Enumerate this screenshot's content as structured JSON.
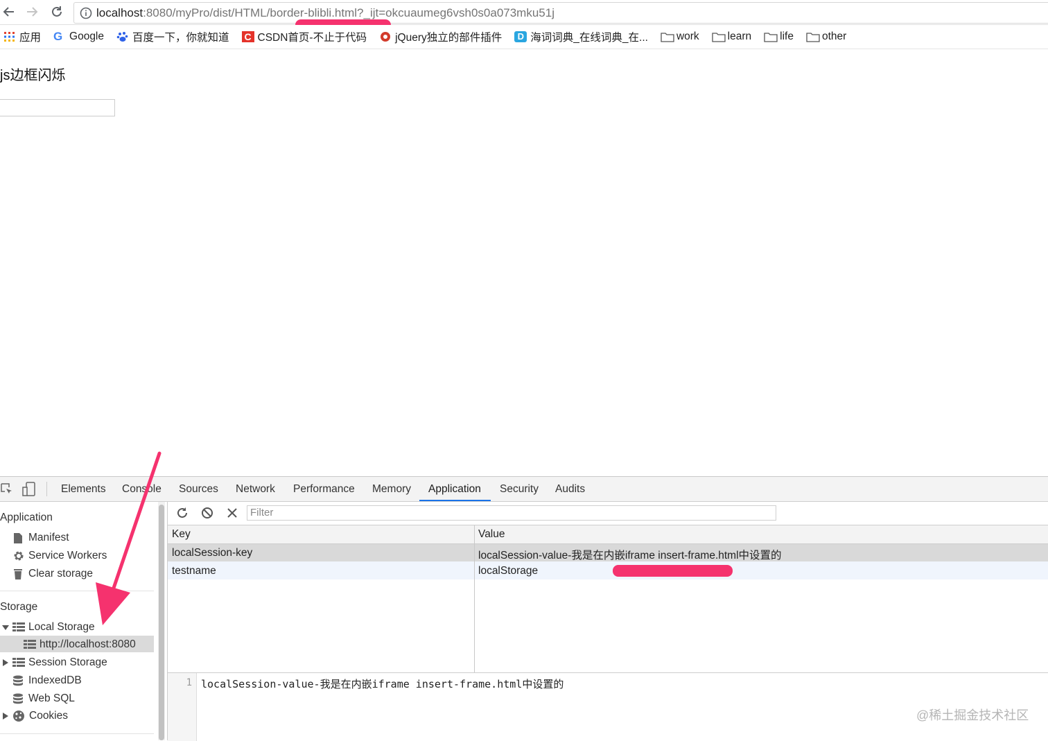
{
  "browser": {
    "url_host": "localhost",
    "url_path": ":8080/myPro/dist/HTML/border-blibli.html?_ijt=okcuaumeg6vsh0s0a073mku51j",
    "bookmarks": [
      {
        "label": "应用",
        "icon": "apps-grid-icon"
      },
      {
        "label": "Google",
        "icon": "google-icon"
      },
      {
        "label": "百度一下，你就知道",
        "icon": "baidu-paw-icon"
      },
      {
        "label": "CSDN首页-不止于代码",
        "icon": "csdn-icon"
      },
      {
        "label": "jQuery独立的部件插件",
        "icon": "jquery-icon"
      },
      {
        "label": "海词词典_在线词典_在...",
        "icon": "dict-icon"
      },
      {
        "label": "work",
        "icon": "folder-icon"
      },
      {
        "label": "learn",
        "icon": "folder-icon"
      },
      {
        "label": "life",
        "icon": "folder-icon"
      },
      {
        "label": "other",
        "icon": "folder-icon"
      }
    ]
  },
  "page": {
    "heading": "js边框闪烁"
  },
  "devtools": {
    "tabs": [
      "Elements",
      "Console",
      "Sources",
      "Network",
      "Performance",
      "Memory",
      "Application",
      "Security",
      "Audits"
    ],
    "active_tab": "Application",
    "sidebar": {
      "application_header": "Application",
      "manifest": "Manifest",
      "service_workers": "Service Workers",
      "clear_storage": "Clear storage",
      "storage_header": "Storage",
      "local_storage": "Local Storage",
      "local_storage_origin": "http://localhost:8080",
      "session_storage": "Session Storage",
      "indexeddb": "IndexedDB",
      "web_sql": "Web SQL",
      "cookies": "Cookies"
    },
    "filter_placeholder": "Filter",
    "table": {
      "columns": [
        "Key",
        "Value"
      ],
      "rows": [
        {
          "key": "localSession-key",
          "value": "localSession-value-我是在内嵌iframe insert-frame.html中设置的"
        },
        {
          "key": "testname",
          "value": "localStorage"
        }
      ]
    },
    "preview": {
      "line_number": "1",
      "text": "localSession-value-我是在内嵌iframe insert-frame.html中设置的"
    }
  },
  "watermark": "@稀土掘金技术社区",
  "colors": {
    "annotation": "#f5326e",
    "active_tab_underline": "#1a73e8"
  }
}
